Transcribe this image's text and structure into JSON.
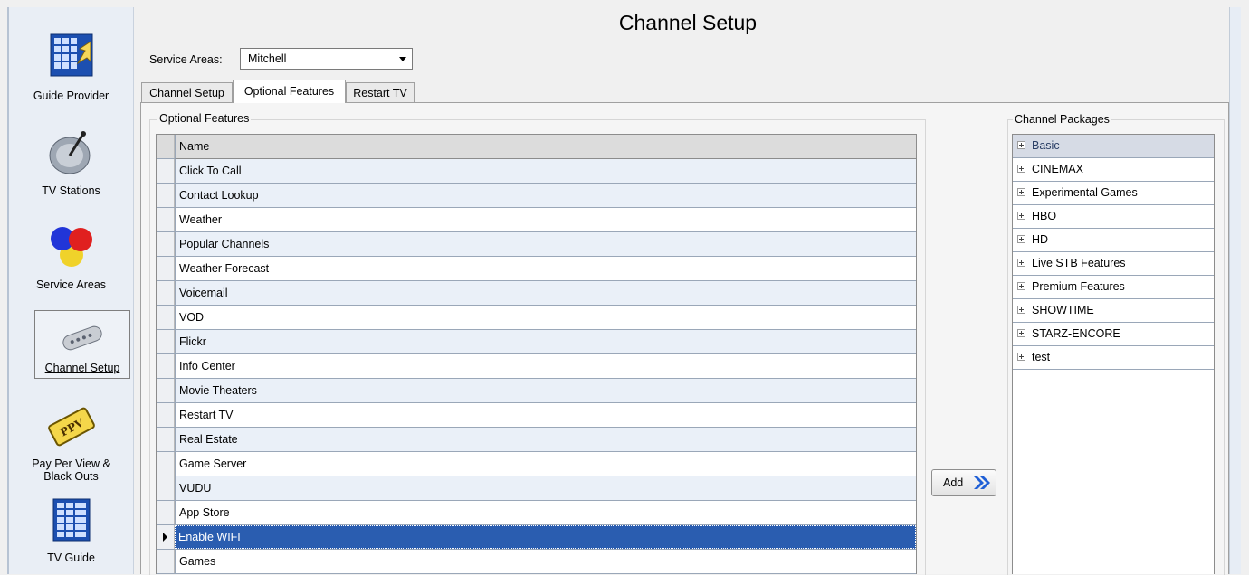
{
  "window_title": "Channel Setup",
  "nav": {
    "items": [
      {
        "label": "Guide Provider",
        "icon": "guide-provider-icon"
      },
      {
        "label": "TV Stations",
        "icon": "satellite-dish-icon"
      },
      {
        "label": "Service Areas",
        "icon": "service-areas-icon"
      },
      {
        "label": "Channel Setup",
        "icon": "remote-control-icon"
      },
      {
        "label": "Pay Per View &",
        "label2": "Black Outs",
        "icon": "ppv-ticket-icon"
      },
      {
        "label": "TV Guide",
        "icon": "tv-guide-icon"
      }
    ]
  },
  "service_areas": {
    "label": "Service Areas:",
    "selected": "Mitchell"
  },
  "tabs": [
    {
      "label": "Channel Setup"
    },
    {
      "label": "Optional Features"
    },
    {
      "label": "Restart TV"
    }
  ],
  "optional_features": {
    "group_label": "Optional Features",
    "column_header": "Name",
    "rows": [
      "Click To Call",
      "Contact Lookup",
      "Weather",
      "Popular Channels",
      "Weather Forecast",
      "Voicemail",
      "VOD",
      "Flickr",
      "Info Center",
      "Movie Theaters",
      "Restart TV",
      "Real Estate",
      "Game Server",
      "VUDU",
      "App Store",
      "Enable WIFI",
      "Games"
    ],
    "selected": "Enable WIFI"
  },
  "add_button": {
    "label": "Add"
  },
  "channel_packages": {
    "group_label": "Channel Packages",
    "items": [
      "Basic",
      "CINEMAX",
      "Experimental Games",
      "HBO",
      "HD",
      "Live STB Features",
      "Premium Features",
      "SHOWTIME",
      "STARZ-ENCORE",
      "test"
    ]
  },
  "colors": {
    "selection": "#2a5db0",
    "row_alt": "#eaf0f8",
    "nav_bg": "#e9eef5"
  }
}
